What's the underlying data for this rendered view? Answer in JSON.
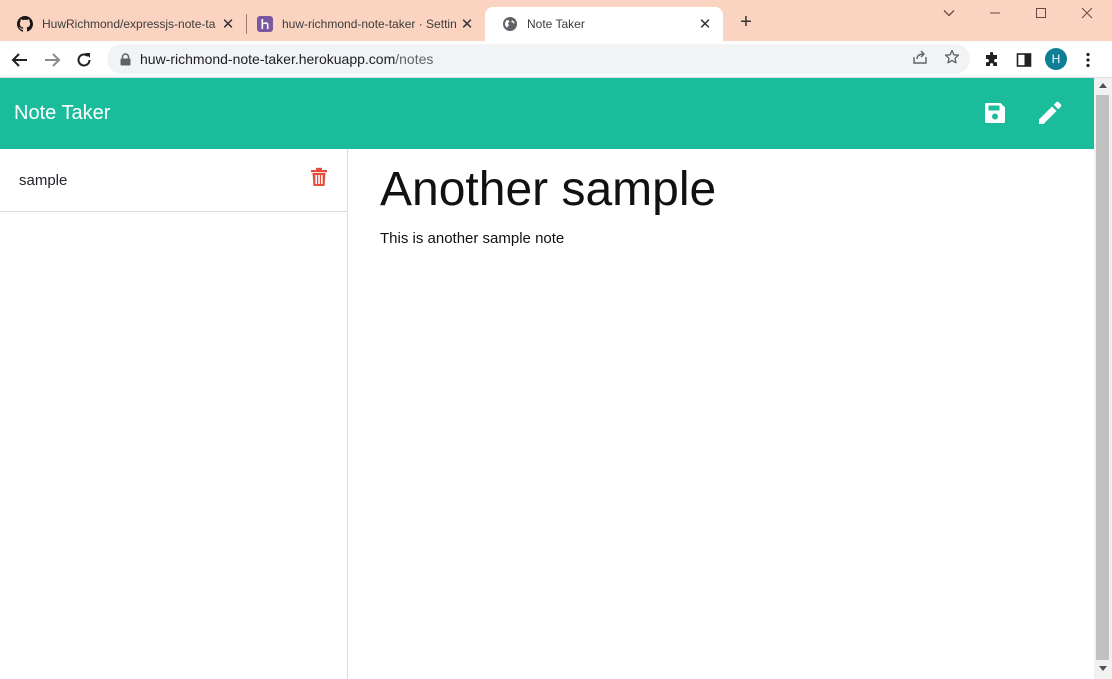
{
  "browser": {
    "tabs": [
      {
        "title": "HuwRichmond/expressjs-note-ta",
        "icon": "github-icon",
        "active": false
      },
      {
        "title": "huw-richmond-note-taker · Settin",
        "icon": "heroku-icon",
        "active": false
      },
      {
        "title": "Note Taker",
        "icon": "globe-icon",
        "active": true
      }
    ],
    "url_host": "huw-richmond-note-taker.herokuapp.com",
    "url_path": "/notes",
    "profile_initial": "H"
  },
  "app": {
    "brand": "Note Taker",
    "accent_color": "#1abc9c",
    "delete_color": "#e74c3c",
    "notes": [
      {
        "title": "sample"
      }
    ],
    "current_note": {
      "title": "Another sample",
      "text": "This is another sample note"
    }
  }
}
